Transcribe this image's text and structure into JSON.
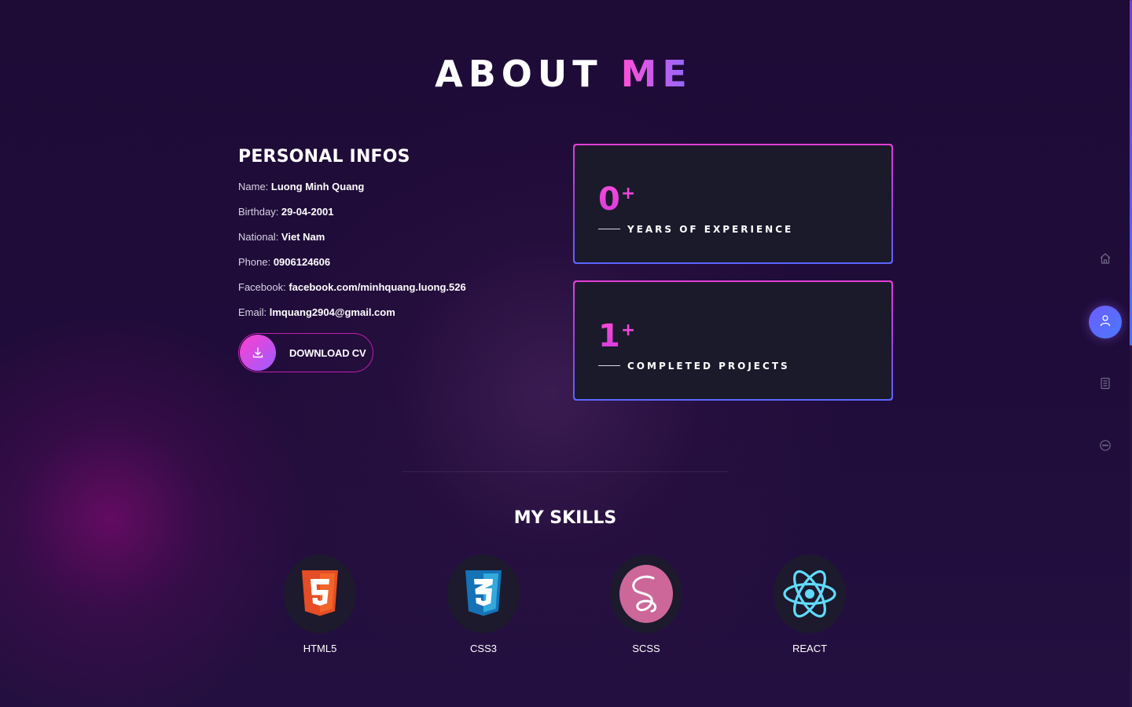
{
  "header": {
    "title_main": "ABOUT ",
    "title_accent": "ME"
  },
  "personal": {
    "heading": "PERSONAL INFOS",
    "rows": [
      {
        "label": "Name: ",
        "value": "Luong Minh Quang"
      },
      {
        "label": "Birthday: ",
        "value": "29-04-2001"
      },
      {
        "label": "National: ",
        "value": "Viet Nam"
      },
      {
        "label": "Phone: ",
        "value": "0906124606"
      },
      {
        "label": "Facebook: ",
        "value": "facebook.com/minhquang.luong.526"
      },
      {
        "label": "Email: ",
        "value": "lmquang2904@gmail.com"
      }
    ],
    "download_label": "DOWNLOAD CV",
    "download_icon": "download-icon"
  },
  "stats": [
    {
      "number": "0",
      "plus": "+",
      "label": "YEARS OF EXPERIENCE"
    },
    {
      "number": "1",
      "plus": "+",
      "label": "COMPLETED PROJECTS"
    }
  ],
  "skills": {
    "heading": "MY SKILLS",
    "items": [
      {
        "label": "HTML5",
        "icon": "html5-logo-icon",
        "color": "#e44d26"
      },
      {
        "label": "CSS3",
        "icon": "css3-logo-icon",
        "color": "#1572b6"
      },
      {
        "label": "SCSS",
        "icon": "sass-logo-icon",
        "color": "#cd6799"
      },
      {
        "label": "REACT",
        "icon": "react-logo-icon",
        "color": "#61dafb"
      }
    ]
  },
  "sidenav": {
    "items": [
      {
        "id": "home",
        "icon": "home-icon"
      },
      {
        "id": "about",
        "icon": "user-icon",
        "active": true
      },
      {
        "id": "resume",
        "icon": "document-icon"
      },
      {
        "id": "contact",
        "icon": "chat-icon"
      }
    ]
  },
  "colors": {
    "accent_pink": "#ff4fd8",
    "accent_purple": "#8a6bff",
    "card_bg": "#1b1a2b",
    "page_bg": "#1e0b36"
  }
}
